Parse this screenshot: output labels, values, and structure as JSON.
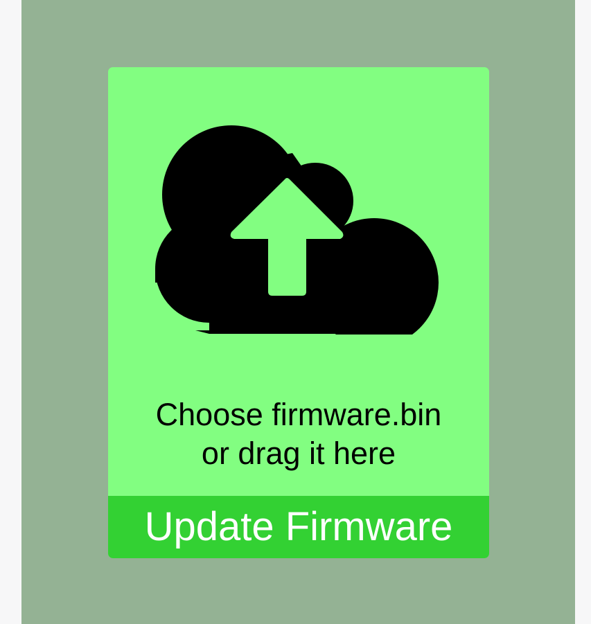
{
  "upload": {
    "prompt_line1": "Choose firmware.bin",
    "prompt_line2": "or drag it here",
    "icon": "cloud-upload-icon",
    "background_color": "#82fe81",
    "icon_color": "#000000"
  },
  "actions": {
    "update_label": "Update Firmware",
    "update_color": "#33d133"
  },
  "page": {
    "background_color": "#94b294"
  }
}
